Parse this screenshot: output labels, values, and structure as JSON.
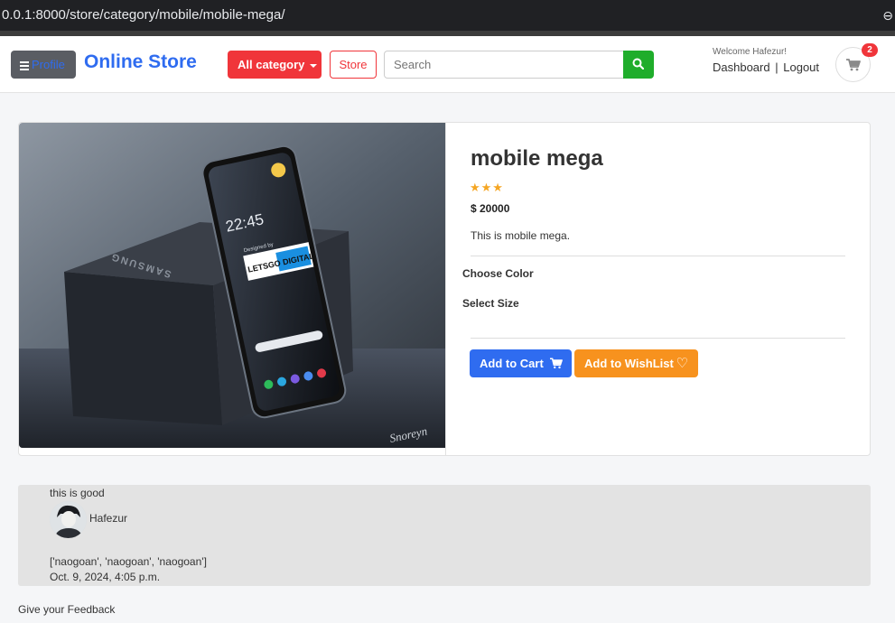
{
  "browser": {
    "url": "0.0.1:8000/store/category/mobile/mobile-mega/"
  },
  "header": {
    "profile_label": "Profile",
    "brand": "Online Store",
    "category_label": "All category",
    "store_label": "Store",
    "search_placeholder": "Search",
    "welcome": "Welcome Hafezur!",
    "dashboard_label": "Dashboard",
    "separator": "|",
    "logout_label": "Logout",
    "cart_count": "2"
  },
  "product": {
    "title": "mobile mega",
    "rating": 3,
    "stars": "★★★",
    "price": "$ 20000",
    "description": "This is mobile mega.",
    "choose_color_label": "Choose Color",
    "select_size_label": "Select Size",
    "add_to_cart_label": "Add to Cart",
    "add_to_wishlist_label": "Add to WishList",
    "image": {
      "time": "22:45",
      "box_brand": "SAMSUNG",
      "watermark_line1": "Designed by",
      "watermark_line2": "LETSGO DIGITAL",
      "signature": "Snoreyn"
    }
  },
  "review": {
    "text": "this is good",
    "reviewer": "Hafezur",
    "tags": "['naogoan', 'naogoan', 'naogoan']",
    "date": "Oct. 9, 2024, 4:05 p.m."
  },
  "feedback_label": "Give your Feedback",
  "colors": {
    "brand_blue": "#2f6cf0",
    "danger_red": "#f0353a",
    "search_green": "#1fad2b",
    "wish_orange": "#f7921e",
    "star_gold": "#f5a623"
  }
}
